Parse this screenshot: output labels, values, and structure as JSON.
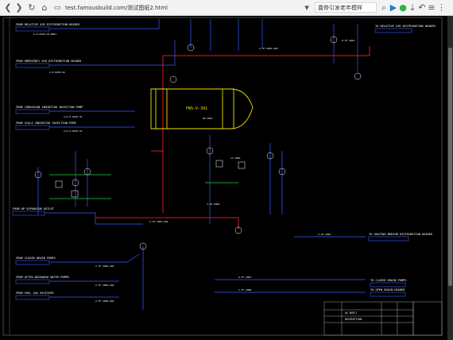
{
  "browser": {
    "url": "test.famousbuild.com/测试图纸2.html",
    "search_placeholder": "露骨引发老年模样",
    "colors": {
      "toolbar_bg": "#f3f3f3",
      "blue_icon": "#1a7fd4",
      "green_icon": "#2cb34a"
    }
  },
  "drawing": {
    "background": "#000000",
    "vessel_label": "FWS-V-301",
    "left_labels": [
      "FROM RELATIVE AIR DISTRIBUTION HEADER",
      "FROM EMERGENCY AIR DISTRIBUTION HEADER",
      "FROM CORROSION INHIBITOR INJECTION PUMP",
      "FROM SCALE INHIBITOR INJECTION PUMP",
      "FROM HP SEPARATOR OUTLET",
      "FROM CLOSED DRAIN PUMPS",
      "FROM AFTER-BACKWASH WATER PUMPS",
      "FROM FUEL GAS RECEIVER"
    ],
    "right_labels": [
      "TO RELATIVE AIR DISTRIBUTION HEADER",
      "TO HEATING MEDIUM DISTRIBUTION HEADER",
      "TO CLOSED DRAIN PUMPS",
      "TO OPEN DRAIN HEADER"
    ],
    "title_block": {
      "label1": "AS BUILT",
      "label2": "DESCRIPTION"
    }
  }
}
